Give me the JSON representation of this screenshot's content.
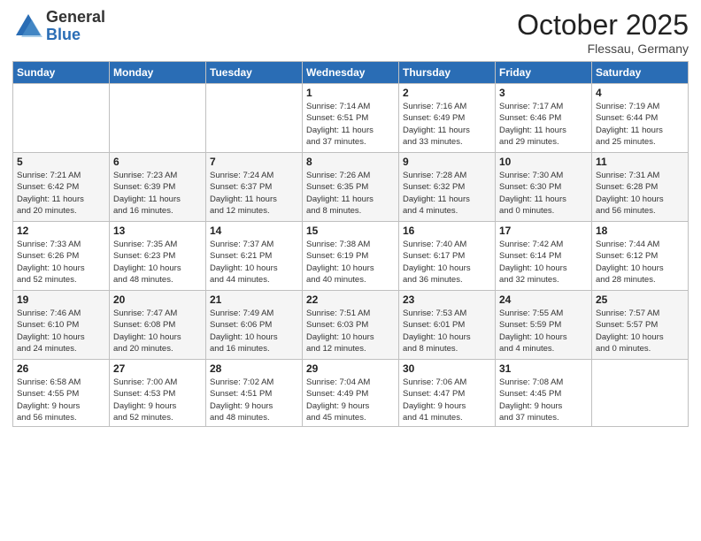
{
  "header": {
    "logo_general": "General",
    "logo_blue": "Blue",
    "month_title": "October 2025",
    "location": "Flessau, Germany"
  },
  "weekdays": [
    "Sunday",
    "Monday",
    "Tuesday",
    "Wednesday",
    "Thursday",
    "Friday",
    "Saturday"
  ],
  "weeks": [
    [
      {
        "day": "",
        "info": ""
      },
      {
        "day": "",
        "info": ""
      },
      {
        "day": "",
        "info": ""
      },
      {
        "day": "1",
        "info": "Sunrise: 7:14 AM\nSunset: 6:51 PM\nDaylight: 11 hours\nand 37 minutes."
      },
      {
        "day": "2",
        "info": "Sunrise: 7:16 AM\nSunset: 6:49 PM\nDaylight: 11 hours\nand 33 minutes."
      },
      {
        "day": "3",
        "info": "Sunrise: 7:17 AM\nSunset: 6:46 PM\nDaylight: 11 hours\nand 29 minutes."
      },
      {
        "day": "4",
        "info": "Sunrise: 7:19 AM\nSunset: 6:44 PM\nDaylight: 11 hours\nand 25 minutes."
      }
    ],
    [
      {
        "day": "5",
        "info": "Sunrise: 7:21 AM\nSunset: 6:42 PM\nDaylight: 11 hours\nand 20 minutes."
      },
      {
        "day": "6",
        "info": "Sunrise: 7:23 AM\nSunset: 6:39 PM\nDaylight: 11 hours\nand 16 minutes."
      },
      {
        "day": "7",
        "info": "Sunrise: 7:24 AM\nSunset: 6:37 PM\nDaylight: 11 hours\nand 12 minutes."
      },
      {
        "day": "8",
        "info": "Sunrise: 7:26 AM\nSunset: 6:35 PM\nDaylight: 11 hours\nand 8 minutes."
      },
      {
        "day": "9",
        "info": "Sunrise: 7:28 AM\nSunset: 6:32 PM\nDaylight: 11 hours\nand 4 minutes."
      },
      {
        "day": "10",
        "info": "Sunrise: 7:30 AM\nSunset: 6:30 PM\nDaylight: 11 hours\nand 0 minutes."
      },
      {
        "day": "11",
        "info": "Sunrise: 7:31 AM\nSunset: 6:28 PM\nDaylight: 10 hours\nand 56 minutes."
      }
    ],
    [
      {
        "day": "12",
        "info": "Sunrise: 7:33 AM\nSunset: 6:26 PM\nDaylight: 10 hours\nand 52 minutes."
      },
      {
        "day": "13",
        "info": "Sunrise: 7:35 AM\nSunset: 6:23 PM\nDaylight: 10 hours\nand 48 minutes."
      },
      {
        "day": "14",
        "info": "Sunrise: 7:37 AM\nSunset: 6:21 PM\nDaylight: 10 hours\nand 44 minutes."
      },
      {
        "day": "15",
        "info": "Sunrise: 7:38 AM\nSunset: 6:19 PM\nDaylight: 10 hours\nand 40 minutes."
      },
      {
        "day": "16",
        "info": "Sunrise: 7:40 AM\nSunset: 6:17 PM\nDaylight: 10 hours\nand 36 minutes."
      },
      {
        "day": "17",
        "info": "Sunrise: 7:42 AM\nSunset: 6:14 PM\nDaylight: 10 hours\nand 32 minutes."
      },
      {
        "day": "18",
        "info": "Sunrise: 7:44 AM\nSunset: 6:12 PM\nDaylight: 10 hours\nand 28 minutes."
      }
    ],
    [
      {
        "day": "19",
        "info": "Sunrise: 7:46 AM\nSunset: 6:10 PM\nDaylight: 10 hours\nand 24 minutes."
      },
      {
        "day": "20",
        "info": "Sunrise: 7:47 AM\nSunset: 6:08 PM\nDaylight: 10 hours\nand 20 minutes."
      },
      {
        "day": "21",
        "info": "Sunrise: 7:49 AM\nSunset: 6:06 PM\nDaylight: 10 hours\nand 16 minutes."
      },
      {
        "day": "22",
        "info": "Sunrise: 7:51 AM\nSunset: 6:03 PM\nDaylight: 10 hours\nand 12 minutes."
      },
      {
        "day": "23",
        "info": "Sunrise: 7:53 AM\nSunset: 6:01 PM\nDaylight: 10 hours\nand 8 minutes."
      },
      {
        "day": "24",
        "info": "Sunrise: 7:55 AM\nSunset: 5:59 PM\nDaylight: 10 hours\nand 4 minutes."
      },
      {
        "day": "25",
        "info": "Sunrise: 7:57 AM\nSunset: 5:57 PM\nDaylight: 10 hours\nand 0 minutes."
      }
    ],
    [
      {
        "day": "26",
        "info": "Sunrise: 6:58 AM\nSunset: 4:55 PM\nDaylight: 9 hours\nand 56 minutes."
      },
      {
        "day": "27",
        "info": "Sunrise: 7:00 AM\nSunset: 4:53 PM\nDaylight: 9 hours\nand 52 minutes."
      },
      {
        "day": "28",
        "info": "Sunrise: 7:02 AM\nSunset: 4:51 PM\nDaylight: 9 hours\nand 48 minutes."
      },
      {
        "day": "29",
        "info": "Sunrise: 7:04 AM\nSunset: 4:49 PM\nDaylight: 9 hours\nand 45 minutes."
      },
      {
        "day": "30",
        "info": "Sunrise: 7:06 AM\nSunset: 4:47 PM\nDaylight: 9 hours\nand 41 minutes."
      },
      {
        "day": "31",
        "info": "Sunrise: 7:08 AM\nSunset: 4:45 PM\nDaylight: 9 hours\nand 37 minutes."
      },
      {
        "day": "",
        "info": ""
      }
    ]
  ]
}
